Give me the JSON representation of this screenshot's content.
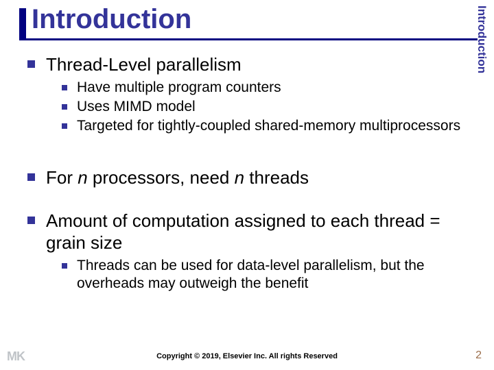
{
  "title": "Introduction",
  "side_label": "Introduction",
  "bullets": {
    "b1": "Thread-Level parallelism",
    "b1_sub": {
      "s1": "Have multiple program counters",
      "s2": "Uses MIMD model",
      "s3": "Targeted for tightly-coupled shared-memory multiprocessors"
    },
    "b2_pre": "For ",
    "b2_n1": "n",
    "b2_mid": " processors, need ",
    "b2_n2": "n",
    "b2_post": " threads",
    "b3": "Amount of computation assigned to each thread = grain size",
    "b3_sub": {
      "s1": "Threads can be used for data-level parallelism, but the overheads may outweigh the benefit"
    }
  },
  "footer": {
    "logo": "MK",
    "copyright": "Copyright © 2019, Elsevier Inc. All rights Reserved",
    "page": "2"
  }
}
